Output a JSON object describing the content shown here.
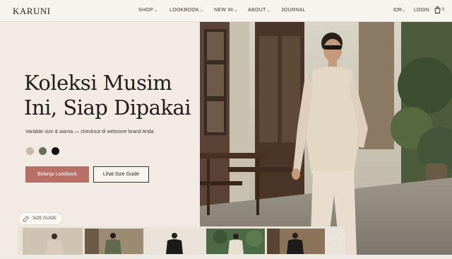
{
  "header": {
    "logo": "KARUNI",
    "nav": [
      {
        "label": "SHOP",
        "dropdown": true
      },
      {
        "label": "LOOKBOOK",
        "dropdown": true
      },
      {
        "label": "NEW IN",
        "dropdown": true
      },
      {
        "label": "ABOUT",
        "dropdown": true
      },
      {
        "label": "JOURNAL",
        "dropdown": false
      }
    ],
    "currency": "IDR",
    "login": "LOGIN",
    "cart_count": "0"
  },
  "hero": {
    "headline_line1": "Koleksi Musim",
    "headline_line2": "Ini, Siap Dipakai",
    "subtitle": "Variable size & warna — checkout di webstore brand Anda",
    "swatches": [
      "#c9b9a6",
      "#6b6b55",
      "#111111"
    ],
    "primary_button": "Belanja Lookbook",
    "secondary_button": "Lihat Size Guide",
    "size_guide_pill": "SIZE GUIDE"
  },
  "colors": {
    "accent": "#b86f66",
    "background": "#f1ebe4"
  },
  "thumbnails": [
    {
      "shirt": "#d8cdbd",
      "bg": "#cfc3b2"
    },
    {
      "shirt": "#5f6a4f",
      "bg": "#9b8b73"
    },
    {
      "shirt": "#1c1a18",
      "bg": "#e9e2d8"
    },
    {
      "shirt": "#e8dfd2",
      "bg": "#4b6a45"
    },
    {
      "shirt": "#1d1b19",
      "bg": "#8a7358"
    }
  ],
  "thumb_nav": {
    "prev": "‹",
    "next": "›"
  }
}
